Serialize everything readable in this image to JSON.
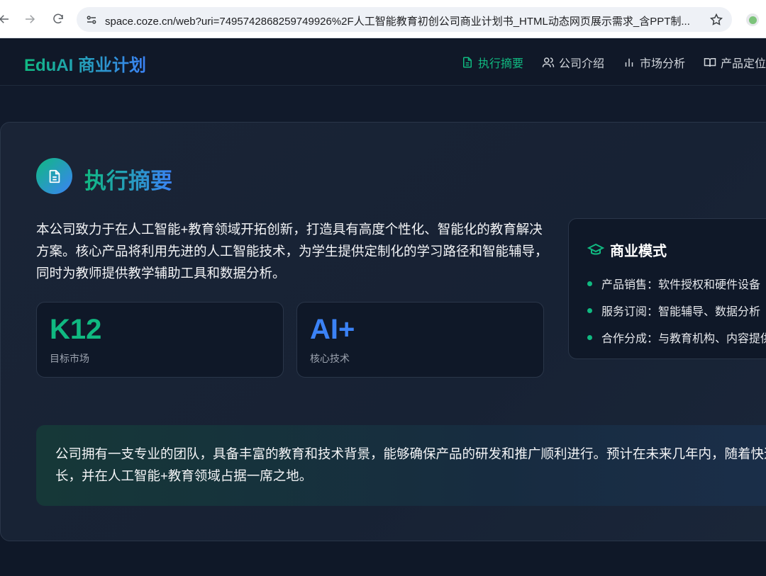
{
  "browser": {
    "url": "space.coze.cn/web?uri=7495742868259749926%2F人工智能教育初创公司商业计划书_HTML动态网页展示需求_含PPT制..."
  },
  "site": {
    "brand": "EduAI 商业计划",
    "nav": [
      {
        "label": "执行摘要",
        "icon": "document-icon",
        "active": true
      },
      {
        "label": "公司介绍",
        "icon": "users-icon",
        "active": false
      },
      {
        "label": "市场分析",
        "icon": "bar-chart-icon",
        "active": false
      },
      {
        "label": "产品定位",
        "icon": "book-icon",
        "active": false
      }
    ]
  },
  "section": {
    "title": "执行摘要",
    "icon": "document-icon",
    "intro": "本公司致力于在人工智能+教育领域开拓创新，打造具有高度个性化、智能化的教育解决方案。核心产品将利用先进的人工智能技术，为学生提供定制化的学习路径和智能辅导，同时为教师提供教学辅助工具和数据分析。",
    "stats": [
      {
        "value": "K12",
        "label": "目标市场",
        "color": "#10b981"
      },
      {
        "value": "AI+",
        "label": "核心技术",
        "color": "#3b82f6"
      }
    ],
    "business_model": {
      "title": "商业模式",
      "icon": "graduation-cap-icon",
      "items": [
        "产品销售：软件授权和硬件设备",
        "服务订阅：智能辅导、数据分析",
        "合作分成：与教育机构、内容提供"
      ]
    },
    "summary": "公司拥有一支专业的团队，具备丰富的教育和技术背景，能够确保产品的研发和推广顺利进行。预计在未来几年内，随着快速增长，并在人工智能+教育领域占据一席之地。"
  },
  "colors": {
    "accent_green": "#10b981",
    "accent_blue": "#3b82f6",
    "background": "#0f1625"
  }
}
